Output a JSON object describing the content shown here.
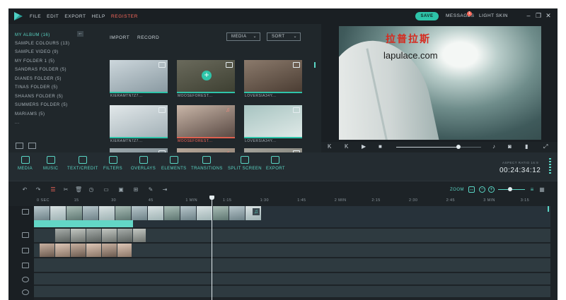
{
  "menu": {
    "items": [
      "FILE",
      "EDIT",
      "EXPORT",
      "HELP"
    ],
    "register": "REGISTER"
  },
  "header": {
    "save": "SAVE",
    "messages": "MESSAGES",
    "messages_count": "1",
    "light_skin": "LIGHT SKIN"
  },
  "library": {
    "items": [
      {
        "label": "MY ALBUM (16)",
        "active": true
      },
      {
        "label": "SAMPLE COLOURS (13)"
      },
      {
        "label": "SAMPLE VIDEO (9)"
      },
      {
        "label": "MY FOLDER 1 (5)"
      },
      {
        "label": "SANDRAS FOLDER (5)"
      },
      {
        "label": "DIANES FOLDER (5)"
      },
      {
        "label": "TINAS FOLDER (5)"
      },
      {
        "label": "SHAANS FOLDER (5)"
      },
      {
        "label": "SUMMERS FOLDER (5)"
      },
      {
        "label": "MARIAMS (5)"
      },
      {
        "label": "..."
      }
    ]
  },
  "media": {
    "import": "IMPORT",
    "record": "RECORD",
    "filter": "MEDIA",
    "sort": "SORT",
    "thumbnails": [
      {
        "name": "KIERAMTN7Z7...",
        "kind": "video",
        "colors": [
          "#cdd7dc",
          "#8a9aa2"
        ]
      },
      {
        "name": "MOOSEFOREST...",
        "kind": "video",
        "colors": [
          "#6a6a5c",
          "#3e4032"
        ]
      },
      {
        "name": "LOVERSIA34Y...",
        "kind": "video",
        "colors": [
          "#8b7a6c",
          "#4b3d33"
        ]
      },
      {
        "name": "KIERAMTN7Z7...",
        "kind": "video",
        "colors": [
          "#e2e8ea",
          "#a3b1b7"
        ]
      },
      {
        "name": "MOOSEFOREST...",
        "kind": "music",
        "colors": [
          "#c9b6a8",
          "#5a4a44"
        ]
      },
      {
        "name": "LOVERSIA34Y...",
        "kind": "video",
        "colors": [
          "#a7c4c1",
          "#dfe9e7"
        ]
      },
      {
        "name": "",
        "kind": "video",
        "colors": [
          "#9ca8ad",
          "#6f7c82"
        ]
      },
      {
        "name": "",
        "kind": "music",
        "colors": [
          "#b7a89a",
          "#7a6c60"
        ]
      },
      {
        "name": "",
        "kind": "video",
        "colors": [
          "#a5a49c",
          "#6e6d66"
        ]
      }
    ]
  },
  "preview": {
    "watermark_cn": "拉普拉斯",
    "watermark_en": "lapulace.com",
    "controls": [
      "K",
      "K",
      "▶",
      "■"
    ],
    "progress": 0.73
  },
  "toolbar": {
    "tools": [
      "MEDIA",
      "MUSIC",
      "TEXT/CREDIT",
      "FILTERS",
      "OVERLAYS",
      "ELEMENTS",
      "TRANSITIONS",
      "SPLIT SCREEN",
      "EXPORT"
    ],
    "aspect_ratio": "ASPECT RATIO 16:9",
    "timecode": "00:24:34:12"
  },
  "timeline": {
    "zoom_label": "ZOOM",
    "zoom_level": 0.45,
    "ruler": [
      "0 SEC",
      "15",
      "30",
      "45",
      "1 MIN",
      "1:15",
      "1:30",
      "1:45",
      "2 MIN",
      "2:15",
      "2:30",
      "2:45",
      "3 MIN",
      "3:15"
    ],
    "colors": {
      "accent": "#2ec4a9",
      "track": "#2e3a40",
      "bg": "#1d2327"
    }
  }
}
